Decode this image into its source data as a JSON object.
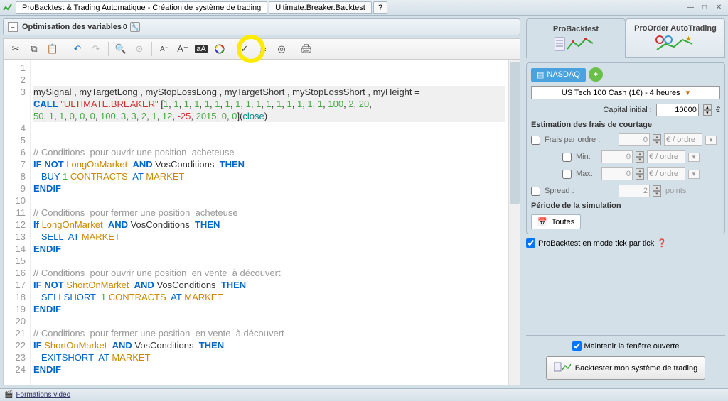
{
  "titlebar": {
    "main_tab": "ProBacktest & Trading Automatique - Création de système de trading",
    "sub_tab": "Ultimate.Breaker.Backtest"
  },
  "optbar": {
    "title": "Optimisation des variables",
    "badge": "0"
  },
  "code": {
    "lines": [
      {
        "n": 1,
        "html": ""
      },
      {
        "n": 2,
        "html": ""
      },
      {
        "n": 3,
        "hl": true,
        "html": "mySignal , myTargetLong , myStopLossLong , myTargetShort , myStopLossShort , myHeight = "
      },
      {
        "n": "",
        "hl": true,
        "html": "<span class='kw'>CALL</span> <span class='str'>\"ULTIMATE.BREAKER\"</span> [<span class='num'>1</span>, <span class='num'>1</span>, <span class='num'>1</span>, <span class='num'>1</span>, <span class='num'>1</span>, <span class='num'>1</span>, <span class='num'>1</span>, <span class='num'>1</span>, <span class='num'>1</span>, <span class='num'>1</span>, <span class='num'>1</span>, <span class='num'>1</span>, <span class='num'>1</span>, <span class='num'>1</span>, <span class='num'>1</span>, <span class='num'>1</span>, <span class='num'>100</span>, <span class='num'>2</span>, <span class='num'>20</span>,"
      },
      {
        "n": "",
        "hl": true,
        "html": "<span class='num'>50</span>, <span class='num'>1</span>, <span class='num'>1</span>, <span class='num'>0</span>, <span class='num'>0</span>, <span class='num'>0</span>, <span class='num'>100</span>, <span class='num'>3</span>, <span class='num'>3</span>, <span class='num'>2</span>, <span class='num'>1</span>, <span class='num'>12</span>, <span class='neg'>-25</span>, <span class='num'>2015</span>, <span class='num'>0</span>, <span class='num'>0</span>](<span class='fn'>close</span>)"
      },
      {
        "n": 4,
        "html": ""
      },
      {
        "n": 5,
        "html": ""
      },
      {
        "n": 6,
        "html": "<span class='com'>// Conditions  pour ouvrir une position  acheteuse</span>"
      },
      {
        "n": 7,
        "html": "<span class='kw'>IF</span> <span class='kw'>NOT</span> <span class='id'>LongOnMarket</span>  <span class='kw'>AND</span> VosConditions  <span class='kw'>THEN</span>"
      },
      {
        "n": 8,
        "html": "   <span class='kw2'>BUY</span> <span class='num'>1</span> <span class='id'>CONTRACTS</span>  <span class='kw2'>AT</span> <span class='id'>MARKET</span>"
      },
      {
        "n": 9,
        "html": "<span class='kw'>ENDIF</span>"
      },
      {
        "n": 10,
        "html": ""
      },
      {
        "n": 11,
        "html": "<span class='com'>// Conditions  pour fermer une position  acheteuse</span>"
      },
      {
        "n": 12,
        "html": "<span class='kw'>If</span> <span class='id'>LongOnMarket</span>  <span class='kw'>AND</span> VosConditions  <span class='kw'>THEN</span>"
      },
      {
        "n": 13,
        "html": "   <span class='kw2'>SELL</span>  <span class='kw2'>AT</span> <span class='id'>MARKET</span>"
      },
      {
        "n": 14,
        "html": "<span class='kw'>ENDIF</span>"
      },
      {
        "n": 15,
        "html": ""
      },
      {
        "n": 16,
        "html": "<span class='com'>// Conditions  pour ouvrir une position  en vente  à découvert</span>"
      },
      {
        "n": 17,
        "html": "<span class='kw'>IF</span> <span class='kw'>NOT</span> <span class='id'>ShortOnMarket</span>  <span class='kw'>AND</span> VosConditions  <span class='kw'>THEN</span>"
      },
      {
        "n": 18,
        "html": "   <span class='kw2'>SELLSHORT</span>  <span class='num'>1</span> <span class='id'>CONTRACTS</span>  <span class='kw2'>AT</span> <span class='id'>MARKET</span>"
      },
      {
        "n": 19,
        "html": "<span class='kw'>ENDIF</span>"
      },
      {
        "n": 20,
        "html": ""
      },
      {
        "n": 21,
        "html": "<span class='com'>// Conditions  pour fermer une position  en vente  à découvert</span>"
      },
      {
        "n": 22,
        "html": "<span class='kw'>IF</span> <span class='id'>ShortOnMarket</span>  <span class='kw'>AND</span> VosConditions  <span class='kw'>THEN</span>"
      },
      {
        "n": 23,
        "html": "   <span class='kw2'>EXITSHORT</span>  <span class='kw2'>AT</span> <span class='id'>MARKET</span>"
      },
      {
        "n": 24,
        "html": "<span class='kw'>ENDIF</span>"
      }
    ]
  },
  "right": {
    "tab1": "ProBacktest",
    "tab2": "ProOrder AutoTrading",
    "market": "NASDAQ",
    "instrument": "US Tech 100 Cash (1€) - 4 heures",
    "capital_label": "Capital initial :",
    "capital_value": "10000",
    "currency": "€",
    "fees_title": "Estimation des frais de courtage",
    "fee_order": "Frais par ordre :",
    "fee_min": "Min:",
    "fee_max": "Max:",
    "fee_val": "0",
    "fee_unit": "€ / ordre",
    "spread_label": "Spread :",
    "spread_val": "2",
    "spread_unit": "points",
    "period_title": "Période de la simulation",
    "period_all": "Toutes",
    "tick_label": "ProBacktest en mode tick par tick",
    "maintain": "Maintenir la fenêtre ouverte",
    "backtest_btn": "Backtester mon système de trading"
  },
  "footer": {
    "link": "Formations vidéo"
  }
}
